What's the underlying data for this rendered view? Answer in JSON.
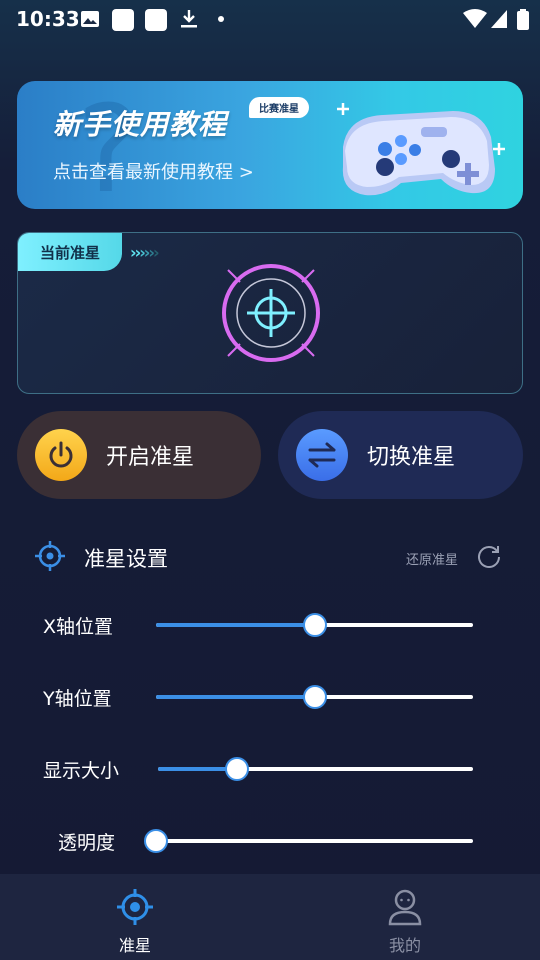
{
  "status_bar": {
    "time": "10:33",
    "icons": [
      "image-icon",
      "square-icon",
      "square-icon",
      "download-icon",
      "dot-icon",
      "wifi-icon",
      "signal-icon",
      "battery-icon"
    ]
  },
  "banner": {
    "title": "新手使用教程",
    "badge": "比赛准星",
    "subtitle": "点击查看最新使用教程 >"
  },
  "crosshair_card": {
    "tab_label": "当前准星",
    "arrows": "›››››"
  },
  "actions": {
    "open_label": "开启准星",
    "switch_label": "切换准星"
  },
  "settings": {
    "title": "准星设置",
    "reset_label": "还原准星",
    "sliders": [
      {
        "label": "X轴位置",
        "value": 0.5
      },
      {
        "label": "Y轴位置",
        "value": 0.5
      },
      {
        "label": "显示大小",
        "value": 0.25
      },
      {
        "label": "透明度",
        "value": 0.0
      }
    ]
  },
  "bottom_nav": {
    "items": [
      {
        "label": "准星",
        "active": true
      },
      {
        "label": "我的",
        "active": false
      }
    ]
  },
  "colors": {
    "accent_blue": "#3b8fe6",
    "cyan": "#55d8e8",
    "active_nav": "#2f8fe8",
    "inactive_nav": "#8a8fa3",
    "crosshair_pink": "#d86bf0"
  }
}
